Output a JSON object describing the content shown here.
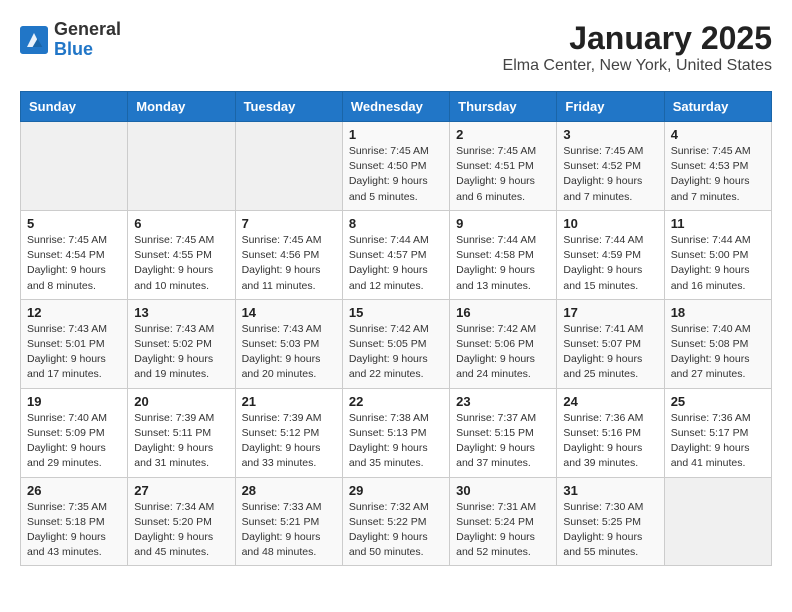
{
  "header": {
    "logo_general": "General",
    "logo_blue": "Blue",
    "calendar_title": "January 2025",
    "calendar_subtitle": "Elma Center, New York, United States"
  },
  "weekdays": [
    "Sunday",
    "Monday",
    "Tuesday",
    "Wednesday",
    "Thursday",
    "Friday",
    "Saturday"
  ],
  "weeks": [
    [
      {
        "day": "",
        "info": ""
      },
      {
        "day": "",
        "info": ""
      },
      {
        "day": "",
        "info": ""
      },
      {
        "day": "1",
        "info": "Sunrise: 7:45 AM\nSunset: 4:50 PM\nDaylight: 9 hours and 5 minutes."
      },
      {
        "day": "2",
        "info": "Sunrise: 7:45 AM\nSunset: 4:51 PM\nDaylight: 9 hours and 6 minutes."
      },
      {
        "day": "3",
        "info": "Sunrise: 7:45 AM\nSunset: 4:52 PM\nDaylight: 9 hours and 7 minutes."
      },
      {
        "day": "4",
        "info": "Sunrise: 7:45 AM\nSunset: 4:53 PM\nDaylight: 9 hours and 7 minutes."
      }
    ],
    [
      {
        "day": "5",
        "info": "Sunrise: 7:45 AM\nSunset: 4:54 PM\nDaylight: 9 hours and 8 minutes."
      },
      {
        "day": "6",
        "info": "Sunrise: 7:45 AM\nSunset: 4:55 PM\nDaylight: 9 hours and 10 minutes."
      },
      {
        "day": "7",
        "info": "Sunrise: 7:45 AM\nSunset: 4:56 PM\nDaylight: 9 hours and 11 minutes."
      },
      {
        "day": "8",
        "info": "Sunrise: 7:44 AM\nSunset: 4:57 PM\nDaylight: 9 hours and 12 minutes."
      },
      {
        "day": "9",
        "info": "Sunrise: 7:44 AM\nSunset: 4:58 PM\nDaylight: 9 hours and 13 minutes."
      },
      {
        "day": "10",
        "info": "Sunrise: 7:44 AM\nSunset: 4:59 PM\nDaylight: 9 hours and 15 minutes."
      },
      {
        "day": "11",
        "info": "Sunrise: 7:44 AM\nSunset: 5:00 PM\nDaylight: 9 hours and 16 minutes."
      }
    ],
    [
      {
        "day": "12",
        "info": "Sunrise: 7:43 AM\nSunset: 5:01 PM\nDaylight: 9 hours and 17 minutes."
      },
      {
        "day": "13",
        "info": "Sunrise: 7:43 AM\nSunset: 5:02 PM\nDaylight: 9 hours and 19 minutes."
      },
      {
        "day": "14",
        "info": "Sunrise: 7:43 AM\nSunset: 5:03 PM\nDaylight: 9 hours and 20 minutes."
      },
      {
        "day": "15",
        "info": "Sunrise: 7:42 AM\nSunset: 5:05 PM\nDaylight: 9 hours and 22 minutes."
      },
      {
        "day": "16",
        "info": "Sunrise: 7:42 AM\nSunset: 5:06 PM\nDaylight: 9 hours and 24 minutes."
      },
      {
        "day": "17",
        "info": "Sunrise: 7:41 AM\nSunset: 5:07 PM\nDaylight: 9 hours and 25 minutes."
      },
      {
        "day": "18",
        "info": "Sunrise: 7:40 AM\nSunset: 5:08 PM\nDaylight: 9 hours and 27 minutes."
      }
    ],
    [
      {
        "day": "19",
        "info": "Sunrise: 7:40 AM\nSunset: 5:09 PM\nDaylight: 9 hours and 29 minutes."
      },
      {
        "day": "20",
        "info": "Sunrise: 7:39 AM\nSunset: 5:11 PM\nDaylight: 9 hours and 31 minutes."
      },
      {
        "day": "21",
        "info": "Sunrise: 7:39 AM\nSunset: 5:12 PM\nDaylight: 9 hours and 33 minutes."
      },
      {
        "day": "22",
        "info": "Sunrise: 7:38 AM\nSunset: 5:13 PM\nDaylight: 9 hours and 35 minutes."
      },
      {
        "day": "23",
        "info": "Sunrise: 7:37 AM\nSunset: 5:15 PM\nDaylight: 9 hours and 37 minutes."
      },
      {
        "day": "24",
        "info": "Sunrise: 7:36 AM\nSunset: 5:16 PM\nDaylight: 9 hours and 39 minutes."
      },
      {
        "day": "25",
        "info": "Sunrise: 7:36 AM\nSunset: 5:17 PM\nDaylight: 9 hours and 41 minutes."
      }
    ],
    [
      {
        "day": "26",
        "info": "Sunrise: 7:35 AM\nSunset: 5:18 PM\nDaylight: 9 hours and 43 minutes."
      },
      {
        "day": "27",
        "info": "Sunrise: 7:34 AM\nSunset: 5:20 PM\nDaylight: 9 hours and 45 minutes."
      },
      {
        "day": "28",
        "info": "Sunrise: 7:33 AM\nSunset: 5:21 PM\nDaylight: 9 hours and 48 minutes."
      },
      {
        "day": "29",
        "info": "Sunrise: 7:32 AM\nSunset: 5:22 PM\nDaylight: 9 hours and 50 minutes."
      },
      {
        "day": "30",
        "info": "Sunrise: 7:31 AM\nSunset: 5:24 PM\nDaylight: 9 hours and 52 minutes."
      },
      {
        "day": "31",
        "info": "Sunrise: 7:30 AM\nSunset: 5:25 PM\nDaylight: 9 hours and 55 minutes."
      },
      {
        "day": "",
        "info": ""
      }
    ]
  ]
}
